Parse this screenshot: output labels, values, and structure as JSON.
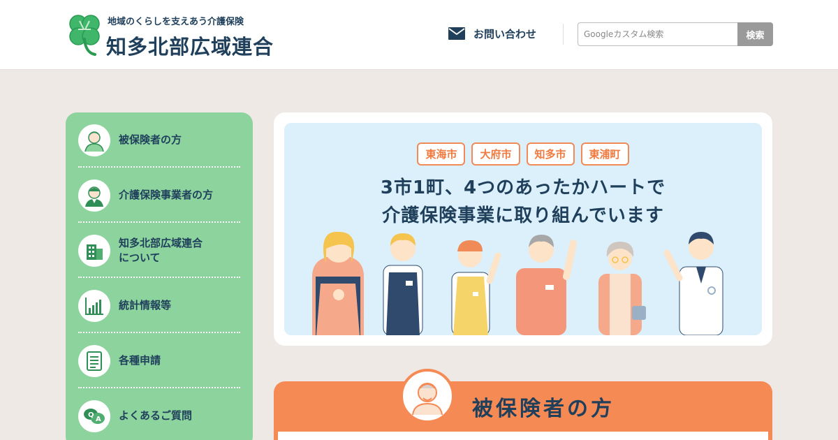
{
  "header": {
    "tagline": "地域のくらしを支えあう介護保険",
    "org_name": "知多北部広域連合",
    "contact_label": "お問い合わせ",
    "search_placeholder": "Googleカスタム検索",
    "search_button": "検索"
  },
  "sidebar": {
    "items": [
      {
        "label": "被保険者の方",
        "icon": "elderly-person-icon"
      },
      {
        "label": "介護保険事業者の方",
        "icon": "care-worker-icon"
      },
      {
        "label": "知多北部広域連合\nについて",
        "icon": "building-icon"
      },
      {
        "label": "統計情報等",
        "icon": "bar-chart-icon"
      },
      {
        "label": "各種申請",
        "icon": "document-icon"
      },
      {
        "label": "よくあるご質問",
        "icon": "qa-bubble-icon"
      }
    ]
  },
  "hero": {
    "badges": [
      "東海市",
      "大府市",
      "知多市",
      "東浦町"
    ],
    "headline_line1": "3市1町、4つのあったかハートで",
    "headline_line2": "介護保険事業に取り組んでいます"
  },
  "section": {
    "title": "被保険者の方",
    "icon": "elderly-person-icon"
  },
  "colors": {
    "navy": "#1f3f5b",
    "sidebar_green": "#8dd39e",
    "hero_blue": "#dbf0fb",
    "accent_orange": "#f58a55"
  }
}
